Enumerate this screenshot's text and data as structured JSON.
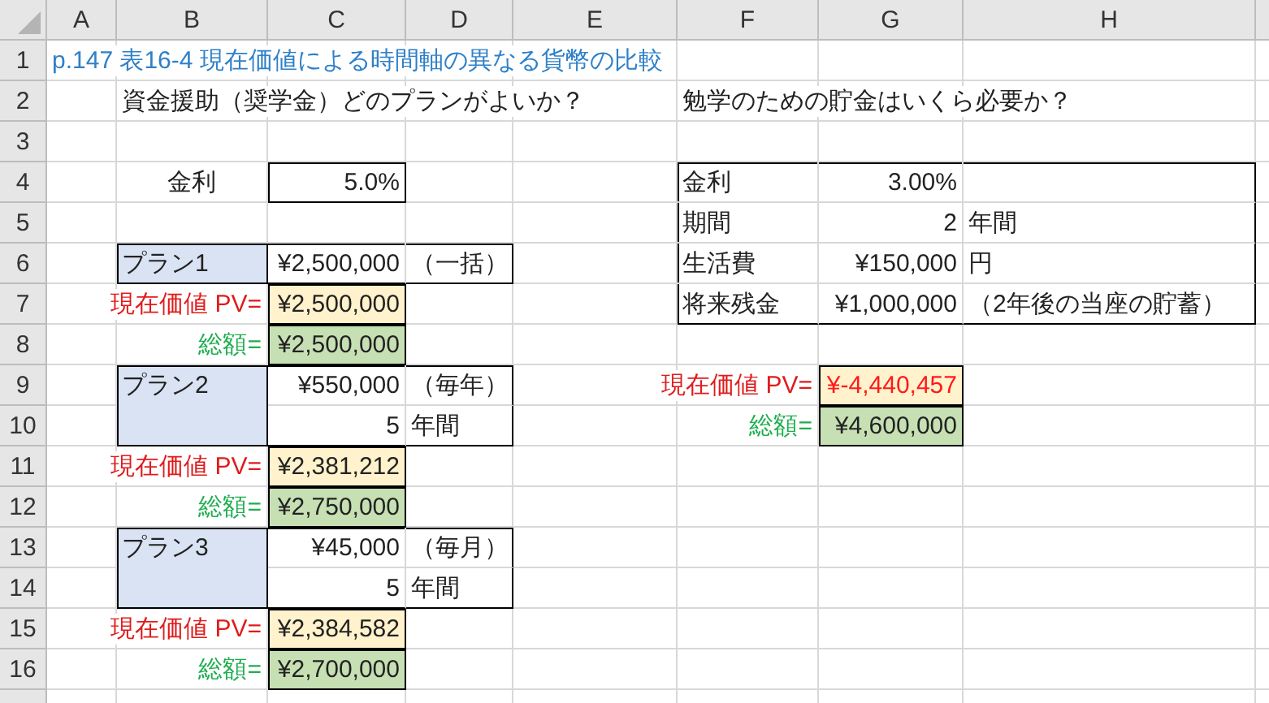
{
  "columns": [
    "A",
    "B",
    "C",
    "D",
    "E",
    "F",
    "G",
    "H"
  ],
  "rows": [
    {
      "header": "1",
      "cells": [
        {
          "text": "p.147 表16-4 現在価値による時間軸の異なる貨幣の比較",
          "kind": "title"
        }
      ]
    },
    {
      "header": "2",
      "cells": [
        null,
        {
          "text": "資金援助（奨学金）どのプランがよいか？",
          "kind": "label"
        },
        null,
        null,
        null,
        {
          "text": "勉学のための貯金はいくら必要か？",
          "kind": "label"
        }
      ]
    },
    {
      "header": "3",
      "cells": []
    },
    {
      "header": "4",
      "cells": [
        null,
        {
          "text": "金利",
          "kind": "centered-label"
        },
        {
          "text": "5.0%",
          "kind": "value",
          "border_top": true,
          "border_left": true,
          "border_right": true,
          "border_bottom": true
        },
        null,
        null,
        {
          "text": "金利",
          "kind": "label",
          "border_top": true,
          "border_left": true
        },
        {
          "text": "3.00%",
          "kind": "value",
          "border_top": true
        },
        {
          "kind": "label",
          "border_top": true,
          "border_right": true
        }
      ]
    },
    {
      "header": "5",
      "cells": [
        null,
        null,
        null,
        null,
        null,
        {
          "text": "期間",
          "kind": "label",
          "border_left": true
        },
        {
          "text": "2",
          "kind": "value"
        },
        {
          "text": "年間",
          "kind": "label",
          "border_right": true
        }
      ]
    },
    {
      "header": "6",
      "cells": [
        null,
        {
          "text": "プラン1",
          "kind": "plan",
          "merged_down": false,
          "border_top": true,
          "border_left": true,
          "border_right": true,
          "border_bottom": true
        },
        {
          "text": "¥2,500,000",
          "kind": "value",
          "border_top": true,
          "border_bottom": true
        },
        {
          "text": "（一括）",
          "kind": "label",
          "border_top": true,
          "border_right": true,
          "border_bottom": true
        },
        null,
        {
          "text": "生活費",
          "kind": "label",
          "border_left": true
        },
        {
          "text": "¥150,000",
          "kind": "value"
        },
        {
          "text": "円",
          "kind": "label",
          "border_right": true
        }
      ]
    },
    {
      "header": "7",
      "cells": [
        null,
        {
          "text": "現在価値 PV=",
          "kind": "pv-label"
        },
        {
          "text": "¥2,500,000",
          "kind": "pv-value",
          "border_top": true,
          "border_left": true,
          "border_right": true,
          "border_bottom": true
        },
        null,
        null,
        {
          "text": "将来残金",
          "kind": "label",
          "border_left": true,
          "border_bottom": true
        },
        {
          "text": "¥1,000,000",
          "kind": "value",
          "border_bottom": true
        },
        {
          "text": "（2年後の当座の貯蓄）",
          "kind": "label",
          "border_right": true,
          "border_bottom": true
        }
      ]
    },
    {
      "header": "8",
      "cells": [
        null,
        {
          "text": "総額=",
          "kind": "total-label"
        },
        {
          "text": "¥2,500,000",
          "kind": "total-value",
          "border_top": true,
          "border_left": true,
          "border_right": true,
          "border_bottom": true
        }
      ]
    },
    {
      "header": "9",
      "cells": [
        null,
        {
          "text": "プラン2",
          "kind": "plan",
          "merged_down": true,
          "border_top": true,
          "border_left": true,
          "border_right": true,
          "border_bottom": true
        },
        {
          "text": "¥550,000",
          "kind": "value",
          "border_top": true
        },
        {
          "text": "（毎年）",
          "kind": "label",
          "border_top": true,
          "border_right": true
        },
        null,
        {
          "text": "現在価値 PV=",
          "kind": "pv-label"
        },
        {
          "text": "¥-4,440,457",
          "kind": "pv-value-negative",
          "border_top": true,
          "border_left": true,
          "border_right": true,
          "border_bottom": true
        }
      ]
    },
    {
      "header": "10",
      "cells": [
        null,
        null,
        {
          "text": "5",
          "kind": "value",
          "border_bottom": true
        },
        {
          "text": "年間",
          "kind": "label",
          "border_right": true,
          "border_bottom": true
        },
        null,
        {
          "text": "総額=",
          "kind": "total-label"
        },
        {
          "text": "¥4,600,000",
          "kind": "total-value",
          "border_top": true,
          "border_left": true,
          "border_right": true,
          "border_bottom": true
        }
      ]
    },
    {
      "header": "11",
      "cells": [
        null,
        {
          "text": "現在価値 PV=",
          "kind": "pv-label"
        },
        {
          "text": "¥2,381,212",
          "kind": "pv-value",
          "border_top": true,
          "border_left": true,
          "border_right": true,
          "border_bottom": true
        }
      ]
    },
    {
      "header": "12",
      "cells": [
        null,
        {
          "text": "総額=",
          "kind": "total-label"
        },
        {
          "text": "¥2,750,000",
          "kind": "total-value",
          "border_top": true,
          "border_left": true,
          "border_right": true,
          "border_bottom": true
        }
      ]
    },
    {
      "header": "13",
      "cells": [
        null,
        {
          "text": "プラン3",
          "kind": "plan",
          "merged_down": true,
          "border_top": true,
          "border_left": true,
          "border_right": true,
          "border_bottom": true
        },
        {
          "text": "¥45,000",
          "kind": "value",
          "border_top": true
        },
        {
          "text": "（毎月）",
          "kind": "label",
          "border_top": true,
          "border_right": true
        }
      ]
    },
    {
      "header": "14",
      "cells": [
        null,
        null,
        {
          "text": "5",
          "kind": "value",
          "border_bottom": true
        },
        {
          "text": "年間",
          "kind": "label",
          "border_right": true,
          "border_bottom": true
        }
      ]
    },
    {
      "header": "15",
      "cells": [
        null,
        {
          "text": "現在価値 PV=",
          "kind": "pv-label"
        },
        {
          "text": "¥2,384,582",
          "kind": "pv-value",
          "border_top": true,
          "border_left": true,
          "border_right": true,
          "border_bottom": true
        }
      ]
    },
    {
      "header": "16",
      "cells": [
        null,
        {
          "text": "総額=",
          "kind": "total-label"
        },
        {
          "text": "¥2,700,000",
          "kind": "total-value",
          "border_top": true,
          "border_left": true,
          "border_right": true,
          "border_bottom": true
        }
      ]
    }
  ]
}
